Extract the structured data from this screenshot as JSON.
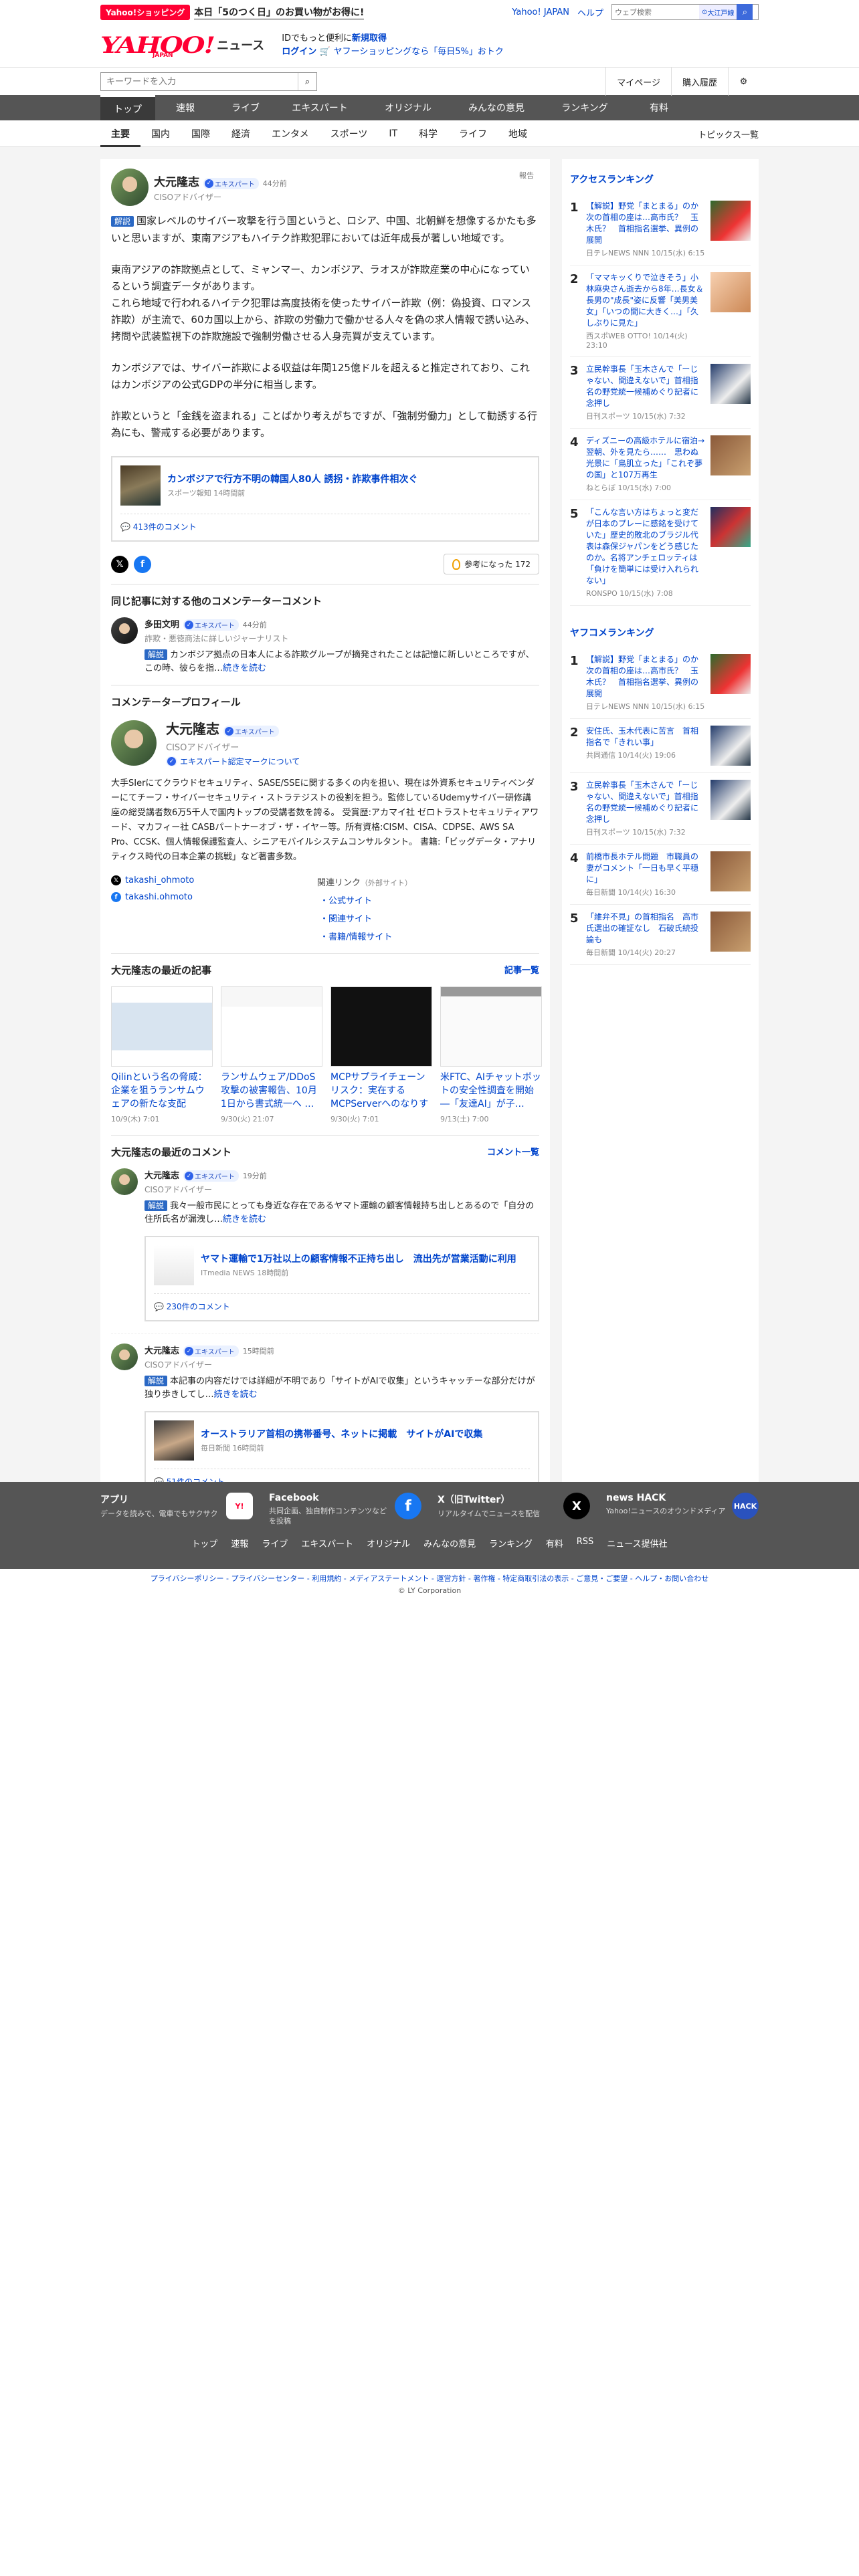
{
  "promo": {
    "badge": "Yahoo!ショッピング",
    "text": "本日「5のつく日」のお買い物がお得に!"
  },
  "util": {
    "yahoo": "Yahoo! JAPAN",
    "help": "ヘルプ",
    "search_placeholder": "ウェブ検索",
    "location": "大江戸線"
  },
  "brand": {
    "logo": "YAHOO!",
    "logo_sub": "JAPAN",
    "news": "ニュース",
    "msg1": "IDでもっと便利に",
    "msg1_link": "新規取得",
    "login": "ログイン",
    "msg2": "ヤフーショッピングなら「毎日5%」おトク"
  },
  "search": {
    "placeholder": "キーワードを入力",
    "mypage": "マイページ",
    "history": "購入履歴"
  },
  "gnav": [
    "トップ",
    "速報",
    "ライブ",
    "エキスパート",
    "オリジナル",
    "みんなの意見",
    "ランキング",
    "有料"
  ],
  "snav": [
    "主要",
    "国内",
    "国際",
    "経済",
    "エンタメ",
    "スポーツ",
    "IT",
    "科学",
    "ライフ",
    "地域"
  ],
  "snav_topics": "トピックス一覧",
  "article": {
    "name": "大元隆志",
    "badge": "エキスパート",
    "time": "44分前",
    "role": "CISOアドバイザー",
    "report": "報告",
    "tag": "解説",
    "p1": "国家レベルのサイバー攻撃を行う国というと、ロシア、中国、北朝鮮を想像するかたも多いと思いますが、東南アジアもハイテク詐欺犯罪においては近年成長が著しい地域です。",
    "p2": "東南アジアの詐欺拠点として、ミャンマー、カンボジア、ラオスが詐欺産業の中心になっているという調査データがあります。\nこれら地域で行われるハイテク犯罪は高度技術を使ったサイバー詐欺（例：偽投資、ロマンス詐欺）が主流で、60カ国以上から、詐欺の労働力で働かせる人々を偽の求人情報で誘い込み、拷問や武装監視下の詐欺施設で強制労働させる人身売買が支えています。",
    "p3": "カンボジアでは、サイバー詐欺による収益は年間125億ドルを超えると推定されており、これはカンボジアの公式GDPの半分に相当します。",
    "p4": "詐欺というと「金銭を盗まれる」ことばかり考えがちですが、「強制労働力」として勧誘する行為にも、警戒する必要があります。",
    "card_title": "カンボジアで行方不明の韓国人80人 誘拐・詐欺事件相次ぐ",
    "card_source": "スポーツ報知 14時間前",
    "card_comments": "413件のコメント",
    "helpful": "参考になった 172"
  },
  "others": {
    "heading": "同じ記事に対する他のコメンテーターコメント",
    "name": "多田文明",
    "badge": "エキスパート",
    "time": "44分前",
    "role": "詐欺・悪徳商法に詳しいジャーナリスト",
    "tag": "解説",
    "text": "カンボジア拠点の日本人による詐欺グループが摘発されたことは記憶に新しいところですが、この時、彼らを指…",
    "more": "続きを読む"
  },
  "profile": {
    "heading": "コメンテータープロフィール",
    "name": "大元隆志",
    "badge": "エキスパート",
    "role": "CISOアドバイザー",
    "mark": "エキスパート認定マークについて",
    "bio": "大手SIerにてクラウドセキュリティ、SASE/SSEに関する多くの内を担い、現在は外資系セキュリティベンダーにてチーフ・サイバーセキュリティ・ストラテジストの役割を担う。監修しているUdemyサイバー研修講座の総受講者数6万5千人で国内トップの受講者数を誇る。 受賞歴:アカマイ社 ゼロトラストセキュリティアワード、マカフィー社 CASBパートナーオブ・ザ・イヤー等。所有資格:CISM、CISA、CDPSE、AWS SA Pro、CCSK、個人情報保護監査人、シニアモバイルシステムコンサルタント。 書籍:「ビッグデータ・アナリティクス時代の日本企業の挑戦」など著書多数。",
    "x": "takashi_ohmoto",
    "fb": "takashi.ohmoto",
    "rel_heading": "関連リンク",
    "rel_note": "（外部サイト）",
    "links": [
      "公式サイト",
      "関連サイト",
      "書籍/情報サイト"
    ]
  },
  "recent_articles": {
    "heading": "大元隆志の最近の記事",
    "link": "記事一覧",
    "items": [
      {
        "title": "Qilinという名の脅威：企業を狙うランサムウェアの新たな支配",
        "date": "10/9(木) 7:01"
      },
      {
        "title": "ランサムウェア/DDoS攻撃の被害報告、10月1日から書式統一へ …",
        "date": "9/30(火) 21:07"
      },
      {
        "title": "MCPサプライチェーンリスク：実在するMCPServerへのなりすま…",
        "date": "9/30(火) 7:01"
      },
      {
        "title": "米FTC、AIチャットボットの安全性調査を開始―「友達AI」が子…",
        "date": "9/13(土) 7:00"
      }
    ]
  },
  "recent_comments": {
    "heading": "大元隆志の最近のコメント",
    "link": "コメント一覧",
    "items": [
      {
        "name": "大元隆志",
        "badge": "エキスパート",
        "time": "19分前",
        "role": "CISOアドバイザー",
        "tag": "解説",
        "text": "我々一般市民にとっても身近な存在であるヤマト運輸の顧客情報持ち出しとあるので「自分の住所氏名が漏洩し…",
        "more": "続きを読む",
        "card_title": "ヤマト運輸で1万社以上の顧客情報不正持ち出し　流出先が営業活動に利用",
        "card_source": "ITmedia NEWS 18時間前",
        "card_comments": "230件のコメント"
      },
      {
        "name": "大元隆志",
        "badge": "エキスパート",
        "time": "15時間前",
        "role": "CISOアドバイザー",
        "tag": "解説",
        "text": "本記事の内容だけでは詳細が不明であり「サイトがAIで収集」というキャッチーな部分だけが独り歩きしてし…",
        "more": "続きを読む",
        "card_title": "オーストラリア首相の携帯番号、ネットに掲載　サイトがAIで収集",
        "card_source": "毎日新聞 16時間前",
        "card_comments": "51件のコメント"
      }
    ]
  },
  "access_ranking": {
    "heading": "アクセスランキング",
    "items": [
      {
        "n": "1",
        "title": "【解説】野党「まとまる」のか　次の首相の座は…高市氏？　玉木氏？　首相指名選挙、異例の展開",
        "source": "日テレNEWS NNN 10/15(水) 6:15"
      },
      {
        "n": "2",
        "title": "「ママキッくりで泣きそう」小林麻央さん逝去から8年…長女＆長男の\"成長\"姿に反響「美男美女」「いつの間に大きく…」「久しぶりに見た」",
        "source": "西スポWEB OTTO! 10/14(火) 23:10"
      },
      {
        "n": "3",
        "title": "立民幹事長「玉木さんで「ーじゃない、間違えないで」首相指名の野党統一候補めぐり記者に念押し",
        "source": "日刊スポーツ 10/15(水) 7:32"
      },
      {
        "n": "4",
        "title": "ディズニーの高級ホテルに宿泊→翌朝、外を見たら……　思わぬ光景に「鳥肌立った」「これぞ夢の国」と107万再生",
        "source": "ねとらぼ 10/15(水) 7:00"
      },
      {
        "n": "5",
        "title": "「こんな言い方はちょっと変だが日本のプレーに感銘を受けていた」歴史的敗北のブラジル代表は森保ジャパンをどう感じたのか。名将アンチェロッティは「負けを簡単には受け入れられない」",
        "source": "RONSPO 10/15(水) 7:08"
      }
    ]
  },
  "yahoo_ranking": {
    "heading": "ヤフコメランキング",
    "items": [
      {
        "n": "1",
        "title": "【解説】野党「まとまる」のか　次の首相の座は…高市氏？　玉木氏？　首相指名選挙、異例の展開",
        "source": "日テレNEWS NNN 10/15(水) 6:15"
      },
      {
        "n": "2",
        "title": "安住氏、玉木代表に苦言　首相指名で「きれい事」",
        "source": "共同通信 10/14(火) 19:06"
      },
      {
        "n": "3",
        "title": "立民幹事長「玉木さんで「ーじゃない、間違えないで」首相指名の野党統一候補めぐり記者に念押し",
        "source": "日刊スポーツ 10/15(水) 7:32"
      },
      {
        "n": "4",
        "title": "前橋市長ホテル問題　市職員の妻がコメント「一日も早く平穏に」",
        "source": "毎日新聞 10/14(火) 16:30"
      },
      {
        "n": "5",
        "title": "「維弁不見」の首相指名　高市氏選出の確証なし　石破氏続投論も",
        "source": "毎日新聞 10/14(火) 20:27"
      }
    ]
  },
  "footer": {
    "apps": [
      {
        "title": "アプリ",
        "desc": "データを読みで、電車でもサクサク",
        "icon": "Y!"
      },
      {
        "title": "Facebook",
        "desc": "共同企画、独自制作コンテンツなどを投稿",
        "icon": "f"
      },
      {
        "title": "X（旧Twitter）",
        "desc": "リアルタイムでニュースを配信",
        "icon": "X"
      },
      {
        "title": "news HACK",
        "desc": "Yahoo!ニュースのオウンドメディア",
        "icon": "HACK"
      }
    ],
    "nav": [
      "トップ",
      "速報",
      "ライブ",
      "エキスパート",
      "オリジナル",
      "みんなの意見",
      "ランキング",
      "有料",
      "RSS",
      "ニュース提供社"
    ],
    "legal": "プライバシーポリシー - プライバシーセンター - 利用規約 - メディアステートメント - 運営方針 - 著作権 - 特定商取引法の表示 - ご意見・ご要望 - ヘルプ・お問い合わせ",
    "copyright": "© LY Corporation"
  }
}
